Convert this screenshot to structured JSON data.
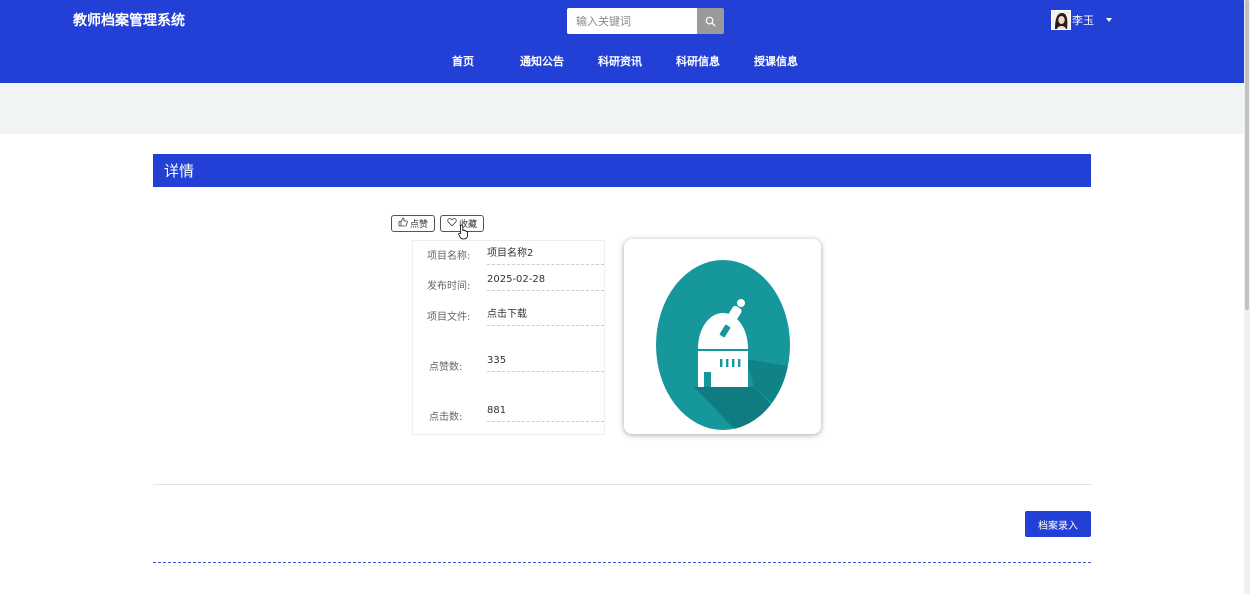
{
  "header": {
    "site_title": "教师档案管理系统",
    "search_placeholder": "输入关键词",
    "user_name": "李玉",
    "accent_color": "#2340d6"
  },
  "nav": {
    "items": [
      {
        "label": "首页"
      },
      {
        "label": "通知公告"
      },
      {
        "label": "科研资讯"
      },
      {
        "label": "科研信息"
      },
      {
        "label": "授课信息"
      }
    ]
  },
  "detail": {
    "section_title": "详情",
    "like_label": "点赞",
    "favorite_label": "收藏",
    "fields": [
      {
        "label": "项目名称:",
        "value": "项目名称2"
      },
      {
        "label": "发布时间:",
        "value": "2025-02-28"
      },
      {
        "label": "项目文件:",
        "value": "点击下载"
      },
      {
        "label": "点赞数:",
        "value": "335"
      },
      {
        "label": "点击数:",
        "value": "881"
      }
    ],
    "image_icon": "observatory-icon"
  },
  "footer": {
    "enter_button_label": "档案录入"
  }
}
